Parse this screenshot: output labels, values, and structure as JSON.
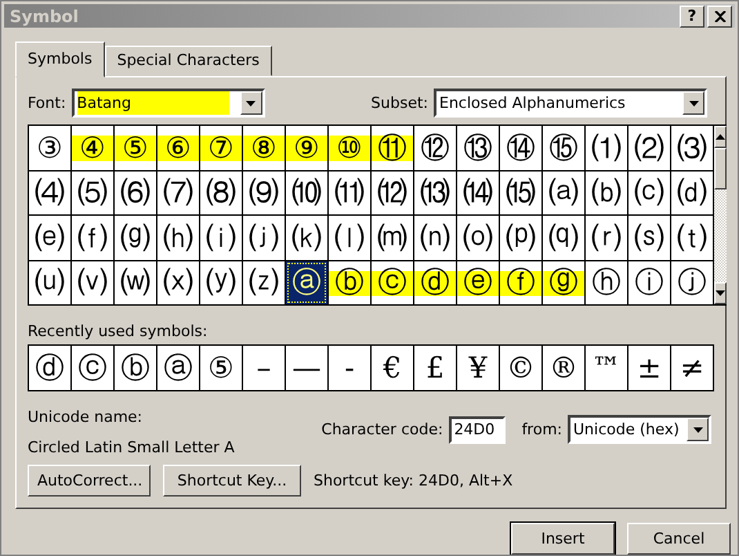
{
  "window": {
    "title": "Symbol",
    "help": "?"
  },
  "tabs": [
    {
      "label": "Symbols",
      "selected": true
    },
    {
      "label": "Special Characters",
      "selected": false
    }
  ],
  "font": {
    "label": "Font:",
    "value": "Batang",
    "highlighted": true
  },
  "subset": {
    "label": "Subset:",
    "value": "Enclosed Alphanumerics"
  },
  "symbol_grid": {
    "rows": [
      [
        {
          "char": "③",
          "selected": false,
          "highlighted": false
        },
        {
          "char": "④",
          "selected": false,
          "highlighted": true
        },
        {
          "char": "⑤",
          "selected": false,
          "highlighted": true
        },
        {
          "char": "⑥",
          "selected": false,
          "highlighted": true
        },
        {
          "char": "⑦",
          "selected": false,
          "highlighted": true
        },
        {
          "char": "⑧",
          "selected": false,
          "highlighted": true
        },
        {
          "char": "⑨",
          "selected": false,
          "highlighted": true
        },
        {
          "char": "⑩",
          "selected": false,
          "highlighted": true
        },
        {
          "char": "⑪",
          "selected": false,
          "highlighted": true
        },
        {
          "char": "⑫",
          "selected": false,
          "highlighted": false
        },
        {
          "char": "⑬",
          "selected": false,
          "highlighted": false
        },
        {
          "char": "⑭",
          "selected": false,
          "highlighted": false
        },
        {
          "char": "⑮",
          "selected": false,
          "highlighted": false
        },
        {
          "char": "⑴",
          "selected": false,
          "highlighted": false
        },
        {
          "char": "⑵",
          "selected": false,
          "highlighted": false
        },
        {
          "char": "⑶",
          "selected": false,
          "highlighted": false
        }
      ],
      [
        {
          "char": "⑷",
          "selected": false,
          "highlighted": false
        },
        {
          "char": "⑸",
          "selected": false,
          "highlighted": false
        },
        {
          "char": "⑹",
          "selected": false,
          "highlighted": false
        },
        {
          "char": "⑺",
          "selected": false,
          "highlighted": false
        },
        {
          "char": "⑻",
          "selected": false,
          "highlighted": false
        },
        {
          "char": "⑼",
          "selected": false,
          "highlighted": false
        },
        {
          "char": "⑽",
          "selected": false,
          "highlighted": false
        },
        {
          "char": "⑾",
          "selected": false,
          "highlighted": false
        },
        {
          "char": "⑿",
          "selected": false,
          "highlighted": false
        },
        {
          "char": "⒀",
          "selected": false,
          "highlighted": false
        },
        {
          "char": "⒁",
          "selected": false,
          "highlighted": false
        },
        {
          "char": "⒂",
          "selected": false,
          "highlighted": false
        },
        {
          "char": "⒜",
          "selected": false,
          "highlighted": false
        },
        {
          "char": "⒝",
          "selected": false,
          "highlighted": false
        },
        {
          "char": "⒞",
          "selected": false,
          "highlighted": false
        },
        {
          "char": "⒟",
          "selected": false,
          "highlighted": false
        }
      ],
      [
        {
          "char": "⒠",
          "selected": false,
          "highlighted": false
        },
        {
          "char": "⒡",
          "selected": false,
          "highlighted": false
        },
        {
          "char": "⒢",
          "selected": false,
          "highlighted": false
        },
        {
          "char": "⒣",
          "selected": false,
          "highlighted": false
        },
        {
          "char": "⒤",
          "selected": false,
          "highlighted": false
        },
        {
          "char": "⒥",
          "selected": false,
          "highlighted": false
        },
        {
          "char": "⒦",
          "selected": false,
          "highlighted": false
        },
        {
          "char": "⒧",
          "selected": false,
          "highlighted": false
        },
        {
          "char": "⒨",
          "selected": false,
          "highlighted": false
        },
        {
          "char": "⒩",
          "selected": false,
          "highlighted": false
        },
        {
          "char": "⒪",
          "selected": false,
          "highlighted": false
        },
        {
          "char": "⒫",
          "selected": false,
          "highlighted": false
        },
        {
          "char": "⒬",
          "selected": false,
          "highlighted": false
        },
        {
          "char": "⒭",
          "selected": false,
          "highlighted": false
        },
        {
          "char": "⒮",
          "selected": false,
          "highlighted": false
        },
        {
          "char": "⒯",
          "selected": false,
          "highlighted": false
        }
      ],
      [
        {
          "char": "⒰",
          "selected": false,
          "highlighted": false
        },
        {
          "char": "⒱",
          "selected": false,
          "highlighted": false
        },
        {
          "char": "⒲",
          "selected": false,
          "highlighted": false
        },
        {
          "char": "⒳",
          "selected": false,
          "highlighted": false
        },
        {
          "char": "⒴",
          "selected": false,
          "highlighted": false
        },
        {
          "char": "⒵",
          "selected": false,
          "highlighted": false
        },
        {
          "char": "ⓐ",
          "selected": true,
          "highlighted": false
        },
        {
          "char": "ⓑ",
          "selected": false,
          "highlighted": true
        },
        {
          "char": "ⓒ",
          "selected": false,
          "highlighted": true
        },
        {
          "char": "ⓓ",
          "selected": false,
          "highlighted": true
        },
        {
          "char": "ⓔ",
          "selected": false,
          "highlighted": true
        },
        {
          "char": "ⓕ",
          "selected": false,
          "highlighted": true
        },
        {
          "char": "ⓖ",
          "selected": false,
          "highlighted": true
        },
        {
          "char": "ⓗ",
          "selected": false,
          "highlighted": false
        },
        {
          "char": "ⓘ",
          "selected": false,
          "highlighted": false
        },
        {
          "char": "ⓙ",
          "selected": false,
          "highlighted": false
        }
      ]
    ]
  },
  "recent": {
    "label": "Recently used symbols:",
    "symbols": [
      "ⓓ",
      "ⓒ",
      "ⓑ",
      "ⓐ",
      "⑤",
      "–",
      "—",
      "-",
      "€",
      "£",
      "¥",
      "©",
      "®",
      "™",
      "±",
      "≠"
    ]
  },
  "unicode_name": {
    "label": "Unicode name:",
    "value": "Circled Latin Small Letter A"
  },
  "character_code": {
    "label": "Character code:",
    "value": "24D0"
  },
  "from": {
    "label": "from:",
    "value": "Unicode (hex)"
  },
  "buttons": [
    {
      "label": "AutoCorrect..."
    },
    {
      "label": "Shortcut Key..."
    }
  ],
  "shortcut_text": "Shortcut key: 24D0, Alt+X",
  "footer_buttons": [
    {
      "label": "Insert",
      "default": true
    },
    {
      "label": "Cancel",
      "default": false
    }
  ]
}
